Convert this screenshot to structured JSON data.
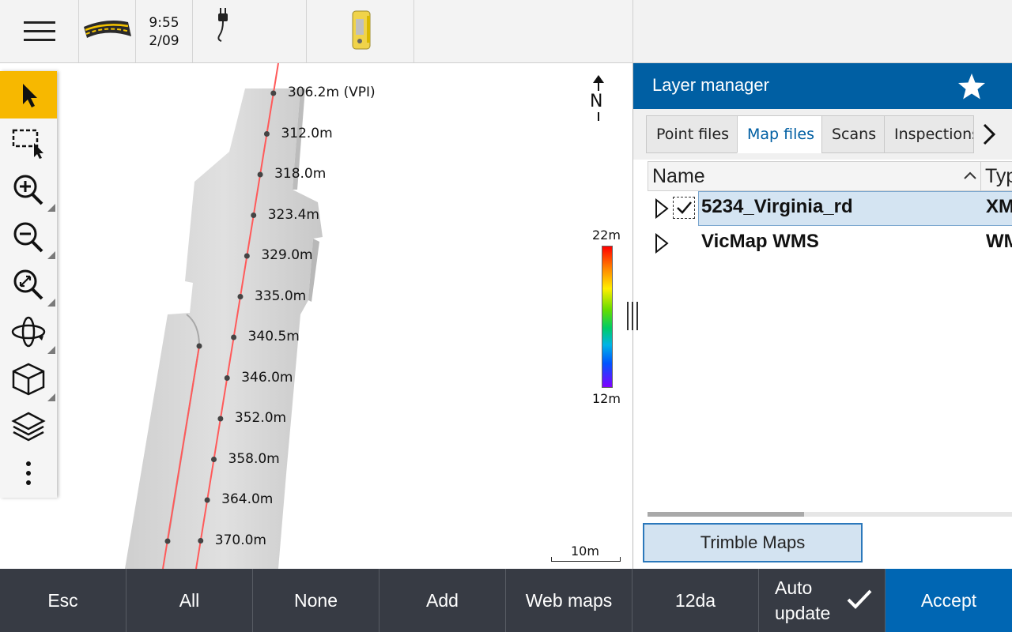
{
  "status_bar": {
    "time": "9:55",
    "date": "2/09",
    "icons": [
      "hamburger-menu-icon",
      "road-icon",
      "power-cable-icon",
      "total-station-icon"
    ]
  },
  "toolbar": {
    "tools": [
      {
        "name": "select-tool",
        "icon": "arrow-pointer-icon",
        "active": true
      },
      {
        "name": "box-select-tool",
        "icon": "box-select-icon"
      },
      {
        "name": "zoom-in-tool",
        "icon": "zoom-in-icon"
      },
      {
        "name": "zoom-out-tool",
        "icon": "zoom-out-icon"
      },
      {
        "name": "zoom-extents-tool",
        "icon": "zoom-extents-icon"
      },
      {
        "name": "orbit-tool",
        "icon": "orbit-icon"
      },
      {
        "name": "view-3d-tool",
        "icon": "cube-icon"
      },
      {
        "name": "layers-tool",
        "icon": "layers-icon"
      },
      {
        "name": "more-tool",
        "icon": "vertical-ellipsis-icon"
      }
    ]
  },
  "map": {
    "chainages": [
      "306.2m (VPI)",
      "312.0m",
      "318.0m",
      "323.4m",
      "329.0m",
      "335.0m",
      "340.5m",
      "346.0m",
      "352.0m",
      "358.0m",
      "364.0m",
      "370.0m"
    ],
    "north_label": "N",
    "legend": {
      "max": "22m",
      "min": "12m"
    },
    "scale": "10m"
  },
  "layer_manager": {
    "title": "Layer manager",
    "tabs": [
      "Point files",
      "Map files",
      "Scans",
      "Inspections"
    ],
    "selected_tab": "Map files",
    "columns": {
      "name": "Name",
      "type": "Typ"
    },
    "rows": [
      {
        "name": "5234_Virginia_rd",
        "type": "XM",
        "checked": true,
        "selected": true
      },
      {
        "name": "VicMap WMS",
        "type": "WM",
        "checked": false,
        "selected": false
      }
    ],
    "trimble_maps": "Trimble Maps"
  },
  "bottom_bar": {
    "esc": "Esc",
    "all": "All",
    "none": "None",
    "add": "Add",
    "web_maps": "Web maps",
    "twelve_da": "12da",
    "auto_line1": "Auto",
    "auto_line2": "update",
    "accept": "Accept"
  },
  "colors": {
    "accent_blue": "#005fa3",
    "active_tool": "#f7b800",
    "bottom_bar": "#373b44",
    "alignment_line": "#ff5a5a"
  }
}
